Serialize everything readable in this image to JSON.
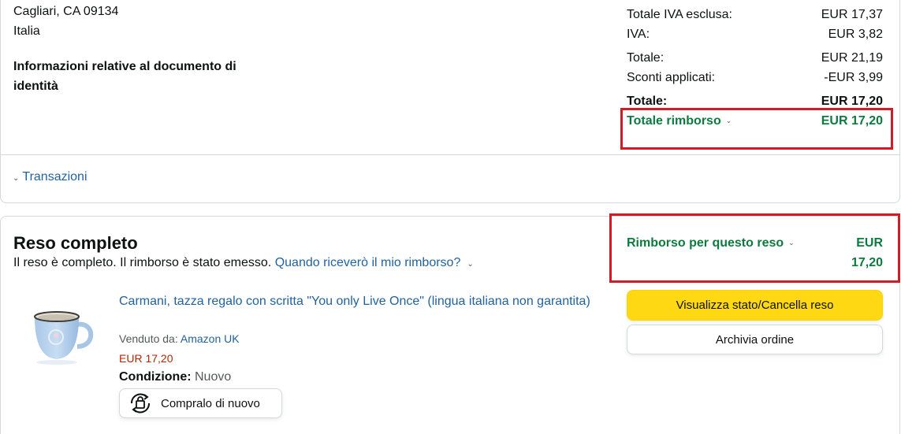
{
  "address": {
    "city_line": "Cagliari, CA 09134",
    "country": "Italia",
    "id_info_heading": "Informazioni relative al documento di identità"
  },
  "summary": {
    "rows": [
      {
        "label": "Totale IVA esclusa:",
        "value": "EUR 17,37"
      },
      {
        "label": "IVA:",
        "value": "EUR 3,82"
      },
      {
        "label": "Totale:",
        "value": "EUR 21,19"
      },
      {
        "label": "Sconti applicati:",
        "value": "-EUR 3,99"
      }
    ],
    "grand_total": {
      "label": "Totale:",
      "value": "EUR 17,20"
    },
    "refund_total": {
      "label": "Totale rimborso",
      "value": "EUR 17,20"
    }
  },
  "transactions": {
    "label": "Transazioni"
  },
  "return_section": {
    "title": "Reso completo",
    "status_text": "Il reso è completo. Il rimborso è stato emesso.",
    "status_link": "Quando riceverò il mio rimborso?",
    "refund_label": "Rimborso per questo reso",
    "refund_currency": "EUR",
    "refund_amount": "17,20"
  },
  "product": {
    "title": "Carmani, tazza regalo con scritta \"You only Live Once\" (lingua italiana non garantita)",
    "sold_by_label": "Venduto da:",
    "seller": "Amazon UK",
    "price": "EUR 17,20",
    "condition_label": "Condizione:",
    "condition_value": "Nuovo",
    "buy_again_label": "Compralo di nuovo"
  },
  "actions": {
    "view_status_label": "Visualizza stato/Cancella reso",
    "archive_label": "Archivia ordine"
  },
  "colors": {
    "link": "#2162a1",
    "green": "#0b7b3e",
    "price": "#b12704",
    "highlight_box": "#d31a26",
    "primary_button": "#ffd814"
  },
  "icons": [
    "chevron-down-icon",
    "buy-again-icon",
    "mug-product-image"
  ]
}
